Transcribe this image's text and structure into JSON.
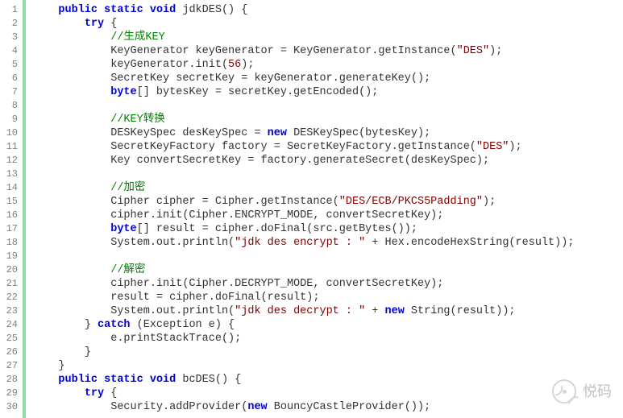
{
  "watermark_label": "悦码",
  "lines": [
    {
      "num": 1,
      "depth": 1,
      "tokens": [
        [
          "kw",
          "public"
        ],
        [
          "id",
          " "
        ],
        [
          "kw",
          "static"
        ],
        [
          "id",
          " "
        ],
        [
          "kw",
          "void"
        ],
        [
          "id",
          " jdkDES() {"
        ]
      ]
    },
    {
      "num": 2,
      "depth": 2,
      "tokens": [
        [
          "kw",
          "try"
        ],
        [
          "id",
          " {"
        ]
      ]
    },
    {
      "num": 3,
      "depth": 3,
      "tokens": [
        [
          "com",
          "//生成KEY"
        ]
      ]
    },
    {
      "num": 4,
      "depth": 3,
      "tokens": [
        [
          "id",
          "KeyGenerator keyGenerator = KeyGenerator.getInstance("
        ],
        [
          "str",
          "\"DES\""
        ],
        [
          "id",
          ");"
        ]
      ]
    },
    {
      "num": 5,
      "depth": 3,
      "tokens": [
        [
          "id",
          "keyGenerator.init("
        ],
        [
          "num",
          "56"
        ],
        [
          "id",
          ");"
        ]
      ]
    },
    {
      "num": 6,
      "depth": 3,
      "tokens": [
        [
          "id",
          "SecretKey secretKey = keyGenerator.generateKey();"
        ]
      ]
    },
    {
      "num": 7,
      "depth": 3,
      "tokens": [
        [
          "kw",
          "byte"
        ],
        [
          "id",
          "[] bytesKey = secretKey.getEncoded();"
        ]
      ]
    },
    {
      "num": 8,
      "depth": 3,
      "tokens": []
    },
    {
      "num": 9,
      "depth": 3,
      "tokens": [
        [
          "com",
          "//KEY转换"
        ]
      ]
    },
    {
      "num": 10,
      "depth": 3,
      "tokens": [
        [
          "id",
          "DESKeySpec desKeySpec = "
        ],
        [
          "kw",
          "new"
        ],
        [
          "id",
          " DESKeySpec(bytesKey);"
        ]
      ]
    },
    {
      "num": 11,
      "depth": 3,
      "tokens": [
        [
          "id",
          "SecretKeyFactory factory = SecretKeyFactory.getInstance("
        ],
        [
          "str",
          "\"DES\""
        ],
        [
          "id",
          ");"
        ]
      ]
    },
    {
      "num": 12,
      "depth": 3,
      "tokens": [
        [
          "id",
          "Key convertSecretKey = factory.generateSecret(desKeySpec);"
        ]
      ]
    },
    {
      "num": 13,
      "depth": 3,
      "tokens": []
    },
    {
      "num": 14,
      "depth": 3,
      "tokens": [
        [
          "com",
          "//加密"
        ]
      ]
    },
    {
      "num": 15,
      "depth": 3,
      "tokens": [
        [
          "id",
          "Cipher cipher = Cipher.getInstance("
        ],
        [
          "str",
          "\"DES/ECB/PKCS5Padding\""
        ],
        [
          "id",
          ");"
        ]
      ]
    },
    {
      "num": 16,
      "depth": 3,
      "tokens": [
        [
          "id",
          "cipher.init(Cipher.ENCRYPT_MODE, convertSecretKey);"
        ]
      ]
    },
    {
      "num": 17,
      "depth": 3,
      "tokens": [
        [
          "kw",
          "byte"
        ],
        [
          "id",
          "[] result = cipher.doFinal(src.getBytes());"
        ]
      ]
    },
    {
      "num": 18,
      "depth": 3,
      "tokens": [
        [
          "id",
          "System.out.println("
        ],
        [
          "str",
          "\"jdk des encrypt : \""
        ],
        [
          "id",
          " + Hex.encodeHexString(result));"
        ]
      ]
    },
    {
      "num": 19,
      "depth": 3,
      "tokens": []
    },
    {
      "num": 20,
      "depth": 3,
      "tokens": [
        [
          "com",
          "//解密"
        ]
      ]
    },
    {
      "num": 21,
      "depth": 3,
      "tokens": [
        [
          "id",
          "cipher.init(Cipher.DECRYPT_MODE, convertSecretKey);"
        ]
      ]
    },
    {
      "num": 22,
      "depth": 3,
      "tokens": [
        [
          "id",
          "result = cipher.doFinal(result);"
        ]
      ]
    },
    {
      "num": 23,
      "depth": 3,
      "tokens": [
        [
          "id",
          "System.out.println("
        ],
        [
          "str",
          "\"jdk des decrypt : \""
        ],
        [
          "id",
          " + "
        ],
        [
          "kw",
          "new"
        ],
        [
          "id",
          " String(result));"
        ]
      ]
    },
    {
      "num": 24,
      "depth": 2,
      "tokens": [
        [
          "id",
          "} "
        ],
        [
          "kw",
          "catch"
        ],
        [
          "id",
          " (Exception e) {"
        ]
      ]
    },
    {
      "num": 25,
      "depth": 3,
      "tokens": [
        [
          "id",
          "e.printStackTrace();"
        ]
      ]
    },
    {
      "num": 26,
      "depth": 2,
      "tokens": [
        [
          "id",
          "}"
        ]
      ]
    },
    {
      "num": 27,
      "depth": 1,
      "tokens": [
        [
          "id",
          "}"
        ]
      ]
    },
    {
      "num": 28,
      "depth": 1,
      "tokens": [
        [
          "kw",
          "public"
        ],
        [
          "id",
          " "
        ],
        [
          "kw",
          "static"
        ],
        [
          "id",
          " "
        ],
        [
          "kw",
          "void"
        ],
        [
          "id",
          " bcDES() {"
        ]
      ]
    },
    {
      "num": 29,
      "depth": 2,
      "tokens": [
        [
          "kw",
          "try"
        ],
        [
          "id",
          " {"
        ]
      ]
    },
    {
      "num": 30,
      "depth": 3,
      "tokens": [
        [
          "id",
          "Security.addProvider("
        ],
        [
          "kw",
          "new"
        ],
        [
          "id",
          " BouncyCastleProvider());"
        ]
      ]
    }
  ]
}
